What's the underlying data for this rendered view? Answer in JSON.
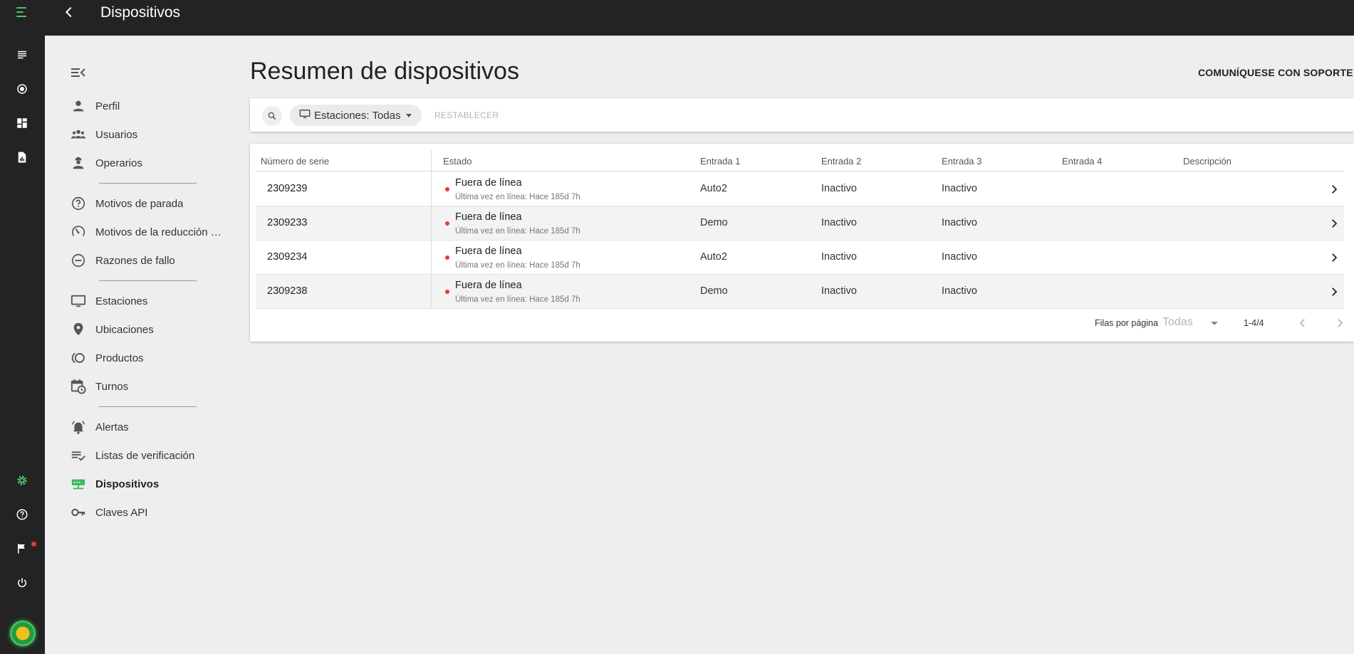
{
  "header": {
    "title": "Dispositivos"
  },
  "rail": {
    "icons": [
      "menu-icon",
      "list-icon",
      "record-icon",
      "dashboard-icon",
      "report-icon",
      "gear-icon",
      "help-icon",
      "flag-icon",
      "power-icon"
    ],
    "notification_dot_color": "#e53935",
    "accent_color": "#4cc36a"
  },
  "sidebar": {
    "items": [
      {
        "label": "Perfil",
        "icon": "person-icon"
      },
      {
        "label": "Usuarios",
        "icon": "group-icon"
      },
      {
        "label": "Operarios",
        "icon": "operator-icon"
      },
      {
        "label": "Motivos de parada",
        "icon": "help-circle-icon"
      },
      {
        "label": "Motivos de la reducción de velocidad",
        "icon": "speed-icon"
      },
      {
        "label": "Razones de fallo",
        "icon": "minus-circle-icon"
      },
      {
        "label": "Estaciones",
        "icon": "monitor-icon"
      },
      {
        "label": "Ubicaciones",
        "icon": "location-icon"
      },
      {
        "label": "Productos",
        "icon": "product-icon"
      },
      {
        "label": "Turnos",
        "icon": "calendar-clock-icon"
      },
      {
        "label": "Alertas",
        "icon": "bell-icon"
      },
      {
        "label": "Listas de verificación",
        "icon": "checklist-icon"
      },
      {
        "label": "Dispositivos",
        "icon": "device-icon",
        "active": true
      },
      {
        "label": "Claves API",
        "icon": "key-icon"
      }
    ]
  },
  "main": {
    "title": "Resumen de dispositivos",
    "support_label": "COMUNÍQUESE CON SOPORTE",
    "filter": {
      "chip_label": "Estaciones: Todas",
      "reset_label": "RESTABLECER"
    },
    "table": {
      "columns": [
        "Número de serie",
        "Estado",
        "Entrada 1",
        "Entrada 2",
        "Entrada 3",
        "Entrada 4",
        "Descripción"
      ],
      "rows": [
        {
          "serial": "2309239",
          "status": "Fuera de línea",
          "last_seen": "Última vez en línea: Hace 185d 7h",
          "input1": "Auto2",
          "input2": "Inactivo",
          "input3": "Inactivo",
          "input4": "",
          "description": ""
        },
        {
          "serial": "2309233",
          "status": "Fuera de línea",
          "last_seen": "Última vez en línea: Hace 185d 7h",
          "input1": "Demo",
          "input2": "Inactivo",
          "input3": "Inactivo",
          "input4": "",
          "description": ""
        },
        {
          "serial": "2309234",
          "status": "Fuera de línea",
          "last_seen": "Última vez en línea: Hace 185d 7h",
          "input1": "Auto2",
          "input2": "Inactivo",
          "input3": "Inactivo",
          "input4": "",
          "description": ""
        },
        {
          "serial": "2309238",
          "status": "Fuera de línea",
          "last_seen": "Última vez en línea: Hace 185d 7h",
          "input1": "Demo",
          "input2": "Inactivo",
          "input3": "Inactivo",
          "input4": "",
          "description": ""
        }
      ],
      "status_color": "#e53935"
    },
    "pagination": {
      "rows_per_page_label": "Filas por página",
      "rows_per_page_value": "Todas",
      "range": "1-4/4"
    }
  }
}
